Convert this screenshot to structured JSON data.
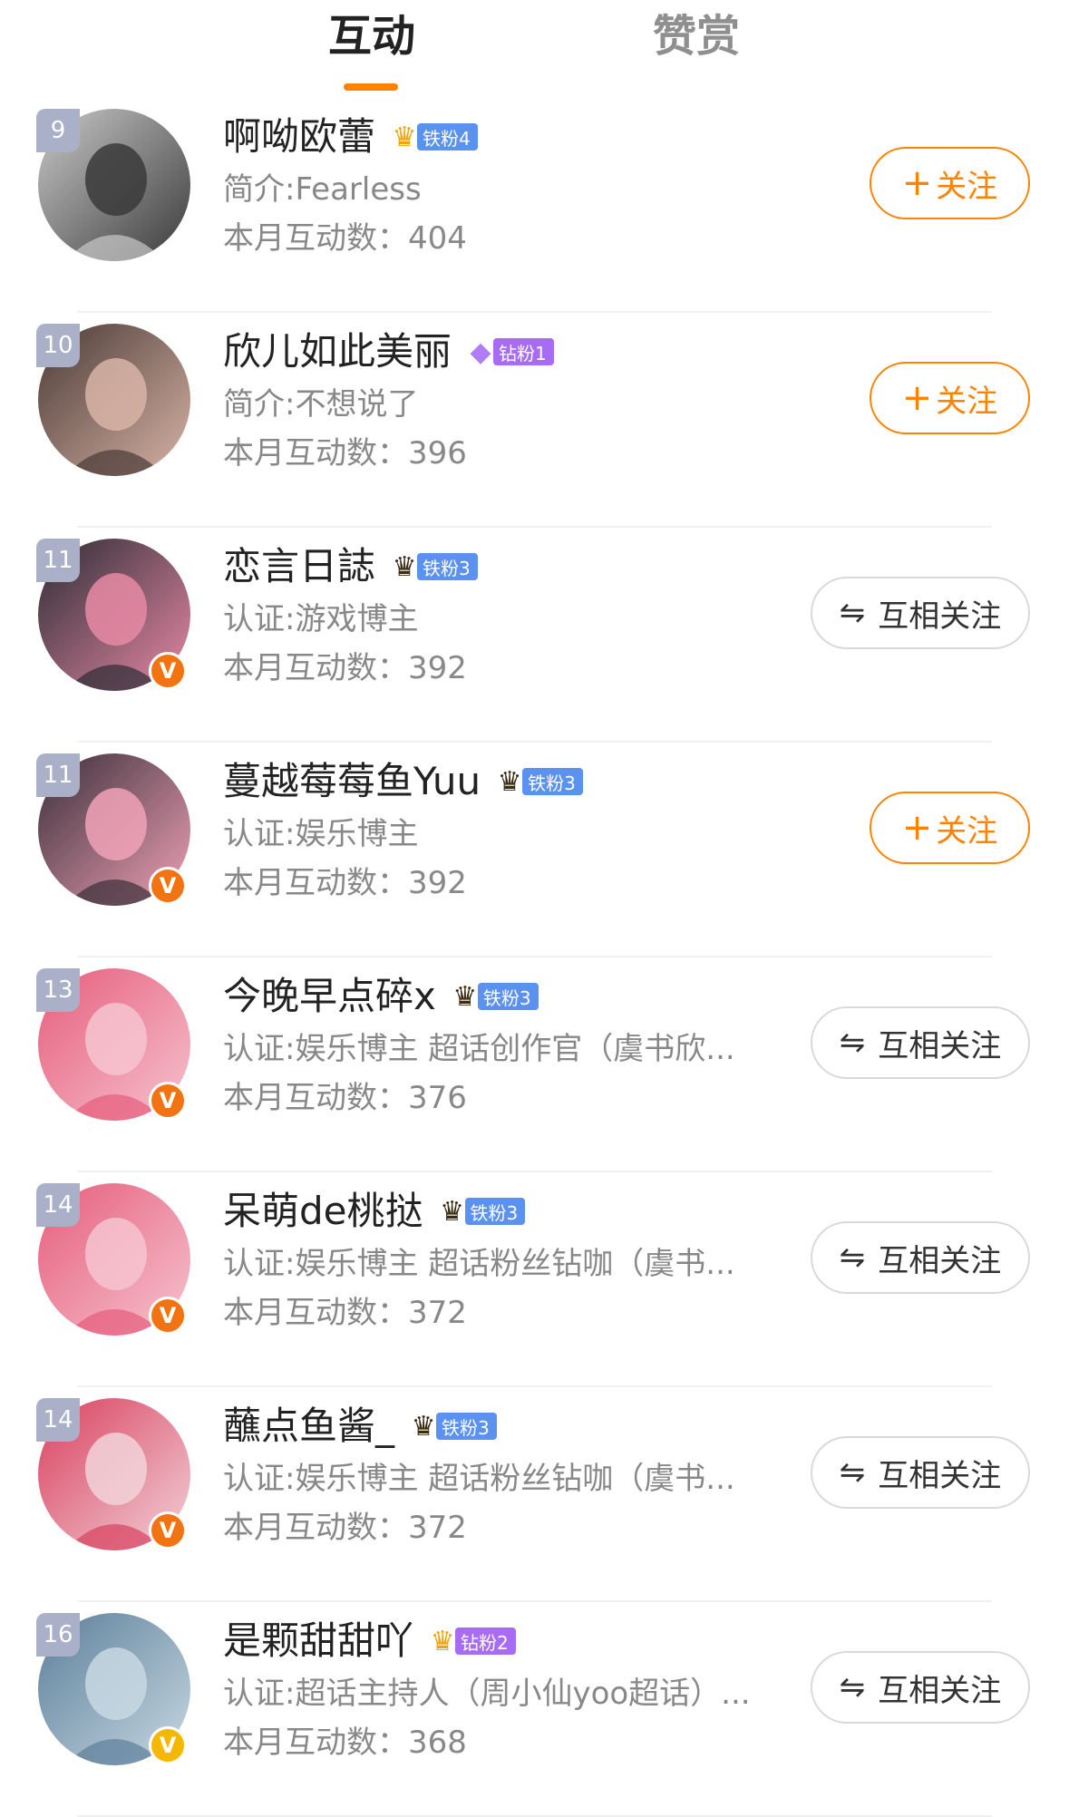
{
  "tabs": {
    "interaction": "互动",
    "reward": "赞赏"
  },
  "buttons": {
    "follow_label": "关注",
    "follow_plus": "+",
    "mutual_label": "互相关注",
    "mutual_icon": "⇋"
  },
  "count_prefix": "本月互动数：",
  "users": [
    {
      "rank": "9",
      "name": "啊呦欧蕾",
      "badge_type": "crown-gold",
      "badge_label": "铁粉4",
      "desc": "简介:Fearless",
      "count": "404",
      "verified": "none",
      "button": "follow",
      "avatar_colors": [
        "#c9c9c9",
        "#3a3a3a"
      ]
    },
    {
      "rank": "10",
      "name": "欣儿如此美丽",
      "badge_type": "diamond",
      "badge_label": "钻粉1",
      "desc": "简介:不想说了",
      "count": "396",
      "verified": "none",
      "button": "follow",
      "avatar_colors": [
        "#4a3a36",
        "#d8b4a6"
      ]
    },
    {
      "rank": "11",
      "name": "恋言日誌",
      "badge_type": "crown",
      "badge_label": "铁粉3",
      "desc": "认证:游戏博主",
      "count": "392",
      "verified": "orange",
      "button": "mutual",
      "avatar_colors": [
        "#2c2c34",
        "#e88aa6"
      ]
    },
    {
      "rank": "11",
      "name": "蔓越莓莓鱼Yuu",
      "badge_type": "crown",
      "badge_label": "铁粉3",
      "desc": "认证:娱乐博主",
      "count": "392",
      "verified": "orange",
      "button": "follow",
      "avatar_colors": [
        "#3a2f38",
        "#f0a2b8"
      ]
    },
    {
      "rank": "13",
      "name": "今晚早点碎x",
      "badge_type": "crown",
      "badge_label": "铁粉3",
      "desc": "认证:娱乐博主 超话创作官（虞书欣...",
      "count": "376",
      "verified": "orange",
      "button": "mutual",
      "avatar_colors": [
        "#e65d7c",
        "#f6c4cf"
      ]
    },
    {
      "rank": "14",
      "name": "呆萌de桃挞",
      "badge_type": "crown",
      "badge_label": "铁粉3",
      "desc": "认证:娱乐博主 超话粉丝钻咖（虞书...",
      "count": "372",
      "verified": "orange",
      "button": "mutual",
      "avatar_colors": [
        "#e65d7c",
        "#f6c4cf"
      ]
    },
    {
      "rank": "14",
      "name": "蘸点鱼酱_",
      "badge_type": "crown",
      "badge_label": "铁粉3",
      "desc": "认证:娱乐博主 超话粉丝钻咖（虞书...",
      "count": "372",
      "verified": "orange",
      "button": "mutual",
      "avatar_colors": [
        "#d9405f",
        "#f2d2d8"
      ]
    },
    {
      "rank": "16",
      "name": "是颗甜甜吖",
      "badge_type": "crown-gold",
      "badge_label": "钻粉2",
      "desc": "认证:超话主持人（周小仙yoo超话）...",
      "count": "368",
      "verified": "gold",
      "button": "mutual",
      "avatar_colors": [
        "#5c7f9a",
        "#c8d8e2"
      ]
    }
  ]
}
